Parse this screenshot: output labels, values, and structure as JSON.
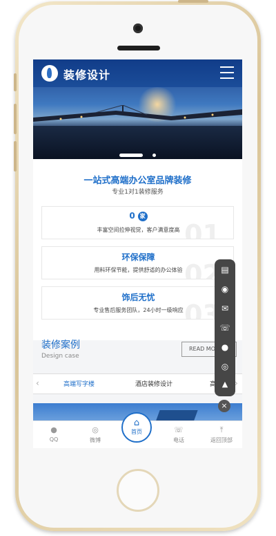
{
  "header": {
    "logo_text": "装修设计"
  },
  "banner": {
    "slide_count": 2,
    "active_slide": 1
  },
  "intro": {
    "title": "一站式高端办公室品牌装修",
    "subtitle": "专业1对1装修服务"
  },
  "features": [
    {
      "title_value": "0",
      "title_badge": "家",
      "desc": "丰富空间拉伸视觉，客户满意度高",
      "bg_number": "01"
    },
    {
      "title": "环保保障",
      "desc": "用料环保节能，提供舒适的办公体验",
      "bg_number": "02"
    },
    {
      "title": "饰后无忧",
      "desc": "专业售后服务团队，24小时一级响应",
      "bg_number": "03"
    }
  ],
  "cases": {
    "title": "装修案例",
    "subtitle": "Design case",
    "read_more": "READ MO"
  },
  "case_tabs": {
    "items": [
      "高端写字楼",
      "酒店装修设计",
      "高端"
    ],
    "active_index": 0
  },
  "float_bar": {
    "icons": [
      "form-icon",
      "qq-service-icon",
      "wechat-icon",
      "phone-icon",
      "qq-icon",
      "weibo-icon",
      "arrow-up-icon"
    ],
    "close": "×"
  },
  "footer": {
    "items": [
      {
        "label": "QQ",
        "icon": "qq-icon"
      },
      {
        "label": "微博",
        "icon": "weibo-icon"
      },
      {
        "label": "首页",
        "icon": "home-icon"
      },
      {
        "label": "电话",
        "icon": "phone-icon"
      },
      {
        "label": "返回顶部",
        "icon": "back-to-top-icon"
      }
    ]
  },
  "colors": {
    "brand_blue": "#1f6fc9",
    "phone_gold": "#d9c497",
    "float_bar": "#464646"
  }
}
